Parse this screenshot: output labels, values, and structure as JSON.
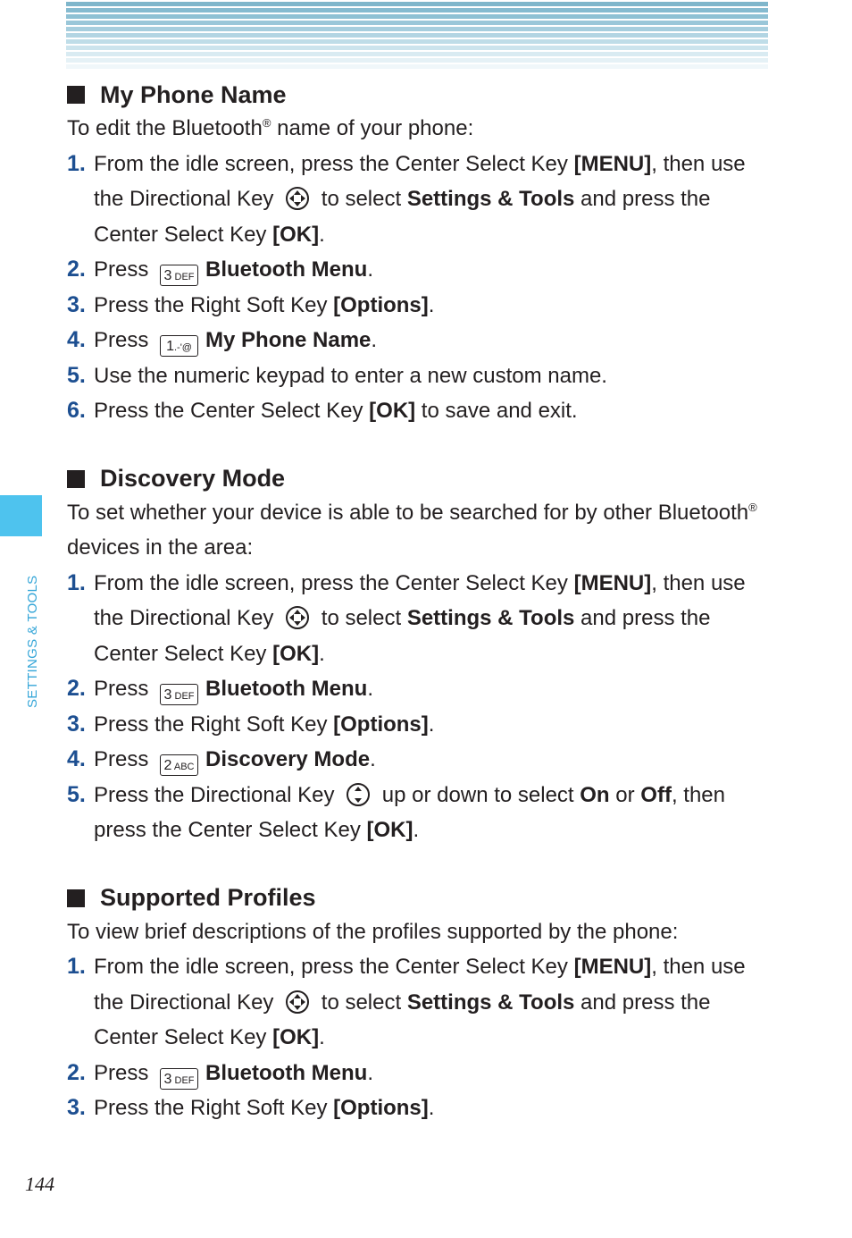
{
  "header": {
    "band_colors": [
      "#7fb6cb",
      "#86bbd0",
      "#8fc1d4",
      "#9ac7d9",
      "#a6cede",
      "#b2d5e3",
      "#bfdde8",
      "#ccE4ed",
      "#d9ebf2",
      "#e5f1f6",
      "#f0f7fa"
    ]
  },
  "side_tab": {
    "label": "SETTINGS & TOOLS",
    "color": "#4ec3ee"
  },
  "sections": [
    {
      "title": "My Phone Name",
      "intro_a": "To edit the Bluetooth",
      "intro_sup": "®",
      "intro_b": " name of your phone:",
      "steps": [
        {
          "n": "1.",
          "a": "From the idle screen, press the Center Select Key ",
          "b1": "[MENU]",
          "c": ", then use the Directional Key ",
          "d": " to select ",
          "b2": "Settings & Tools",
          "e": " and press the Center Select Key ",
          "b3": "[OK]",
          "f": "."
        },
        {
          "n": "2.",
          "a": "Press ",
          "key_num": "3",
          "key_letters": "DEF",
          "b": "Bluetooth Menu",
          "c": "."
        },
        {
          "n": "3.",
          "a": "Press the Right Soft Key ",
          "b": "[Options]",
          "c": "."
        },
        {
          "n": "4.",
          "a": "Press ",
          "key_num": "1",
          "key_letters": ".-'@",
          "b": "My Phone Name",
          "c": "."
        },
        {
          "n": "5.",
          "a": "Use the numeric keypad to enter a new custom name."
        },
        {
          "n": "6.",
          "a": "Press the Center Select Key ",
          "b": "[OK]",
          "c": " to save and exit."
        }
      ]
    },
    {
      "title": "Discovery Mode",
      "intro_a": "To set whether your device is able to be searched for by other Bluetooth",
      "intro_sup": "®",
      "intro_b": " devices in the area:",
      "steps": [
        {
          "n": "1.",
          "a": "From the idle screen, press the Center Select Key ",
          "b1": "[MENU]",
          "c": ", then use the Directional Key ",
          "d": " to select ",
          "b2": "Settings & Tools",
          "e": " and press the Center Select Key ",
          "b3": "[OK]",
          "f": "."
        },
        {
          "n": "2.",
          "a": "Press ",
          "key_num": "3",
          "key_letters": "DEF",
          "b": "Bluetooth Menu",
          "c": "."
        },
        {
          "n": "3.",
          "a": "Press the Right Soft Key ",
          "b": "[Options]",
          "c": "."
        },
        {
          "n": "4.",
          "a": "Press ",
          "key_num": "2",
          "key_letters": "ABC",
          "b": "Discovery Mode",
          "c": "."
        },
        {
          "n": "5.",
          "a": "Press the Directional Key ",
          "c": " up or down to select ",
          "b1": "On",
          "d": " or ",
          "b2": "Off",
          "e": ", then press the Center Select Key ",
          "b3": "[OK]",
          "f": "."
        }
      ]
    },
    {
      "title": "Supported Profiles",
      "intro_a": "To view brief descriptions of the profiles supported by the phone:",
      "steps": [
        {
          "n": "1.",
          "a": "From the idle screen, press the Center Select Key ",
          "b1": "[MENU]",
          "c": ", then use the Directional Key ",
          "d": " to select ",
          "b2": "Settings & Tools",
          "e": " and press the Center Select Key ",
          "b3": "[OK]",
          "f": "."
        },
        {
          "n": "2.",
          "a": "Press ",
          "key_num": "3",
          "key_letters": "DEF",
          "b": "Bluetooth Menu",
          "c": "."
        },
        {
          "n": "3.",
          "a": "Press the Right Soft Key ",
          "b": "[Options]",
          "c": "."
        }
      ]
    }
  ],
  "page_number": "144"
}
